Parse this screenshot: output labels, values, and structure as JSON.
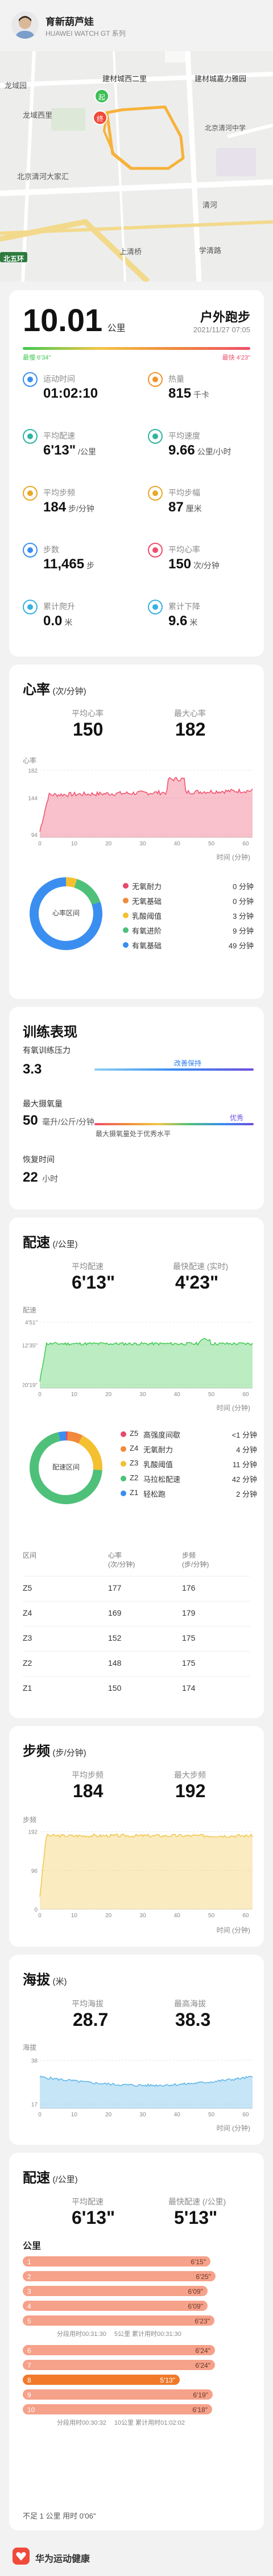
{
  "header": {
    "title": "育新葫芦娃",
    "subtitle": "HUAWEI WATCH GT 系列"
  },
  "map": {
    "labels": [
      "建材城西二里",
      "户外跑步",
      "建材城嘉力雅园",
      "龙域园",
      "龙域西里",
      "北京清河",
      "北京清河中学",
      "北京清河大家汇",
      "北五环",
      "上清桥",
      "清河",
      "学清路",
      "北京科技职业学院"
    ],
    "start_label": "起",
    "end_label": "终"
  },
  "summary": {
    "distance": "10.01",
    "distance_unit": "公里",
    "sport_type": "户外跑步",
    "date": "2021/11/27 07:05",
    "pace_slow": "最慢 6'34\"",
    "pace_fast": "最快 4'23\"",
    "metrics": [
      {
        "icon": "clock-icon",
        "label": "运动时间",
        "value": "01:02:10",
        "unit": "",
        "color": "#3a8ef0"
      },
      {
        "icon": "flame-icon",
        "label": "热量",
        "value": "815",
        "unit": "千卡",
        "color": "#f2932a"
      },
      {
        "icon": "pace-icon",
        "label": "平均配速",
        "value": "6'13\"",
        "unit": "/公里",
        "color": "#2cb5a0"
      },
      {
        "icon": "speedometer-icon",
        "label": "平均速度",
        "value": "9.66",
        "unit": "公里/小时",
        "color": "#2cb5a0"
      },
      {
        "icon": "cadence-icon",
        "label": "平均步频",
        "value": "184",
        "unit": "步/分钟",
        "color": "#e9a828"
      },
      {
        "icon": "stride-icon",
        "label": "平均步幅",
        "value": "87",
        "unit": "厘米",
        "color": "#e9a828"
      },
      {
        "icon": "steps-icon",
        "label": "步数",
        "value": "11,465",
        "unit": "步",
        "color": "#3a8ef0"
      },
      {
        "icon": "heart-icon",
        "label": "平均心率",
        "value": "150",
        "unit": "次/分钟",
        "color": "#ef4e6b"
      },
      {
        "icon": "ascent-icon",
        "label": "累计爬升",
        "value": "0.0",
        "unit": "米",
        "color": "#3ab0e0"
      },
      {
        "icon": "descent-icon",
        "label": "累计下降",
        "value": "9.6",
        "unit": "米",
        "color": "#3ab0e0"
      }
    ]
  },
  "heart": {
    "title": "心率",
    "unit": "(次/分钟)",
    "avg_label": "平均心率",
    "avg_value": "150",
    "max_label": "最大心率",
    "max_value": "182",
    "chart_ylabel": "心率",
    "chart_xlabel": "时间 (分钟)",
    "donut_label": "心率区间",
    "zones": [
      {
        "name": "无氧耐力",
        "time": "0 分钟",
        "color": "#e74a6a"
      },
      {
        "name": "无氧基础",
        "time": "0 分钟",
        "color": "#f08a3c"
      },
      {
        "name": "乳酸阈值",
        "time": "3 分钟",
        "color": "#f4c030"
      },
      {
        "name": "有氧进阶",
        "time": "9 分钟",
        "color": "#4ec07a"
      },
      {
        "name": "有氧基础",
        "time": "49 分钟",
        "color": "#3a8ef0"
      }
    ]
  },
  "training": {
    "title": "训练表现",
    "load_label": "有氧训练压力",
    "load_value": "3.3",
    "load_status": "改善保持",
    "vo2_label": "最大摄氧量",
    "vo2_value": "50",
    "vo2_unit": "毫升/公斤/分钟",
    "vo2_desc": "最大摄氧量处于优秀水平",
    "vo2_status": "优秀",
    "recovery_label": "恢复时间",
    "recovery_value": "22",
    "recovery_unit": "小时"
  },
  "pace": {
    "title": "配速",
    "unit": "(/公里)",
    "avg_label": "平均配速",
    "avg_value": "6'13\"",
    "fast_label": "最快配速 (实时)",
    "fast_value": "4'23\"",
    "chart_ylabel": "配速",
    "chart_xlabel": "时间 (分钟)",
    "donut_label": "配速区间",
    "zones": [
      {
        "code": "Z5",
        "name": "高强度间歇",
        "time": "<1 分钟",
        "color": "#e74a6a"
      },
      {
        "code": "Z4",
        "name": "无氧耐力",
        "time": "4 分钟",
        "color": "#f08a3c"
      },
      {
        "code": "Z3",
        "name": "乳酸阈值",
        "time": "11 分钟",
        "color": "#f4c030"
      },
      {
        "code": "Z2",
        "name": "马拉松配速",
        "time": "42 分钟",
        "color": "#4ec07a"
      },
      {
        "code": "Z1",
        "name": "轻松跑",
        "time": "2 分钟",
        "color": "#3a8ef0"
      }
    ],
    "table": {
      "headers": [
        "区间",
        "心率\n(次/分钟)",
        "步频\n(步/分钟)"
      ],
      "rows": [
        [
          "Z5",
          "177",
          "176"
        ],
        [
          "Z4",
          "169",
          "179"
        ],
        [
          "Z3",
          "152",
          "175"
        ],
        [
          "Z2",
          "148",
          "175"
        ],
        [
          "Z1",
          "150",
          "174"
        ]
      ]
    }
  },
  "cadence": {
    "title": "步频",
    "unit": "(步/分钟)",
    "avg_label": "平均步频",
    "avg_value": "184",
    "max_label": "最大步频",
    "max_value": "192",
    "chart_ylabel": "步频",
    "chart_xlabel": "时间 (分钟)"
  },
  "altitude": {
    "title": "海拔",
    "unit": "(米)",
    "avg_label": "平均海拔",
    "avg_value": "28.7",
    "max_label": "最高海拔",
    "max_value": "38.3",
    "chart_ylabel": "海拔",
    "chart_xlabel": "时间 (分钟)"
  },
  "splits": {
    "title": "配速",
    "unit": "(/公里)",
    "avg_label": "平均配速",
    "avg_value": "6'13\"",
    "fast_label": "最快配速 (/公里)",
    "fast_value": "5'13\"",
    "km_label": "公里",
    "rows": [
      {
        "km": "1",
        "pace": "6'15\""
      },
      {
        "km": "2",
        "pace": "6'25\""
      },
      {
        "km": "3",
        "pace": "6'09\""
      },
      {
        "km": "4",
        "pace": "6'09\""
      },
      {
        "km": "5",
        "pace": "6'23\""
      },
      {
        "km": "6",
        "pace": "6'24\""
      },
      {
        "km": "7",
        "pace": "6'24\""
      },
      {
        "km": "8",
        "pace": "5'13\""
      },
      {
        "km": "9",
        "pace": "6'19\""
      },
      {
        "km": "10",
        "pace": "6'18\""
      }
    ],
    "half1": "分段用时00:31:30",
    "half1b": "5公里 累计用时00:31:30",
    "half2": "分段用时00:30:32",
    "half2b": "10公里 累计用时01:02:02",
    "footer": "不足 1 公里 用时 0'06\""
  },
  "footer": {
    "brand": "华为运动健康"
  },
  "colors": {
    "heart": "#ef4e6b",
    "pace": "#3ec94f",
    "cadence": "#f2c64a",
    "altitude": "#5bb5e8",
    "split_bar": "#f6a18a",
    "split_fast": "#f07a2a"
  }
}
